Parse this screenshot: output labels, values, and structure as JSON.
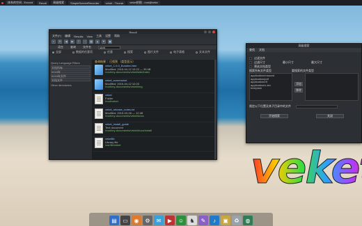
{
  "taskbar": {
    "tasks": [
      "体系的空间 - Excord",
      "Recoll",
      "高级搜索",
      "SimpleScreenRecorder",
      "veket - Thunar",
      "veket把图 - root@veke"
    ]
  },
  "recoll": {
    "title": "Recoll",
    "menus": [
      "文件(F)",
      "编辑",
      "Results",
      "View",
      "工具",
      "设置",
      "帮助"
    ],
    "tabs": [
      "语言",
      "查询",
      "文件名",
      "shell"
    ],
    "radios": [
      "全部",
      "数据的任意项",
      "任意",
      "搜索",
      "图片文件",
      "电子表格",
      "文本文件"
    ],
    "left_panel": {
      "label1": "Query Language Filters",
      "items": [
        "文档所有",
        "2015年",
        "2015年文件",
        "文档文件",
        "Other directories"
      ]
    },
    "results_header": "查询结果 ：已找到 （类型显示）",
    "results": [
      {
        "title": "veket_1.0.0_Bundled.htm",
        "sub": "Modified: 2015-04-12 10:22 — 35 kB",
        "path": "/root/my-documents/veket/site/index"
      },
      {
        "title": "veket_screenshot",
        "sub": "Modified: 2015-04-12 10:20",
        "path": "/root/my-documents/veket/img"
      },
      {
        "title": "veket",
        "sub": "Folder",
        "path": "/root/veket"
      },
      {
        "title": "veket_release_notes.txt",
        "sub": "Modified: 2015-03-28 — 12 kB",
        "path": "/root/my-documents/veket/docs"
      },
      {
        "title": "veket_install_guide",
        "sub": "Text document",
        "path": "/root/my-documents/veket/docs/install"
      },
      {
        "title": "veketlib",
        "sub": "Library file",
        "path": "/usr/lib/veket"
      }
    ]
  },
  "advanced": {
    "title": "高级搜索",
    "tabs": [
      "查找",
      "文档"
    ],
    "label_a": "过滤文件",
    "label_b": "过滤尺寸",
    "min_label": "最小尺寸",
    "max_label": "最大尺寸",
    "filetype_label": "筛选文档类型",
    "search_all_label": "搜索所有文件类型",
    "selected_types_label": "要搜索的文件类型",
    "types": [
      "application/msword",
      "application/pdf",
      "application/rtf",
      "application/x-tex",
      "text/plain"
    ],
    "add_btn": "添加",
    "remove_btn": "移除",
    "bottom_label": "限定以下位置及其子目录中的文件",
    "search_btn": "开始搜索",
    "close_btn": "关闭"
  },
  "logo_text": "veket",
  "dock": {
    "icons": [
      "folder-icon",
      "terminal-icon",
      "browser-icon",
      "settings-icon",
      "mail-icon",
      "media-icon",
      "chat-icon",
      "game-icon",
      "editor-icon",
      "music-icon",
      "image-icon",
      "recycle-icon",
      "network-icon"
    ]
  }
}
